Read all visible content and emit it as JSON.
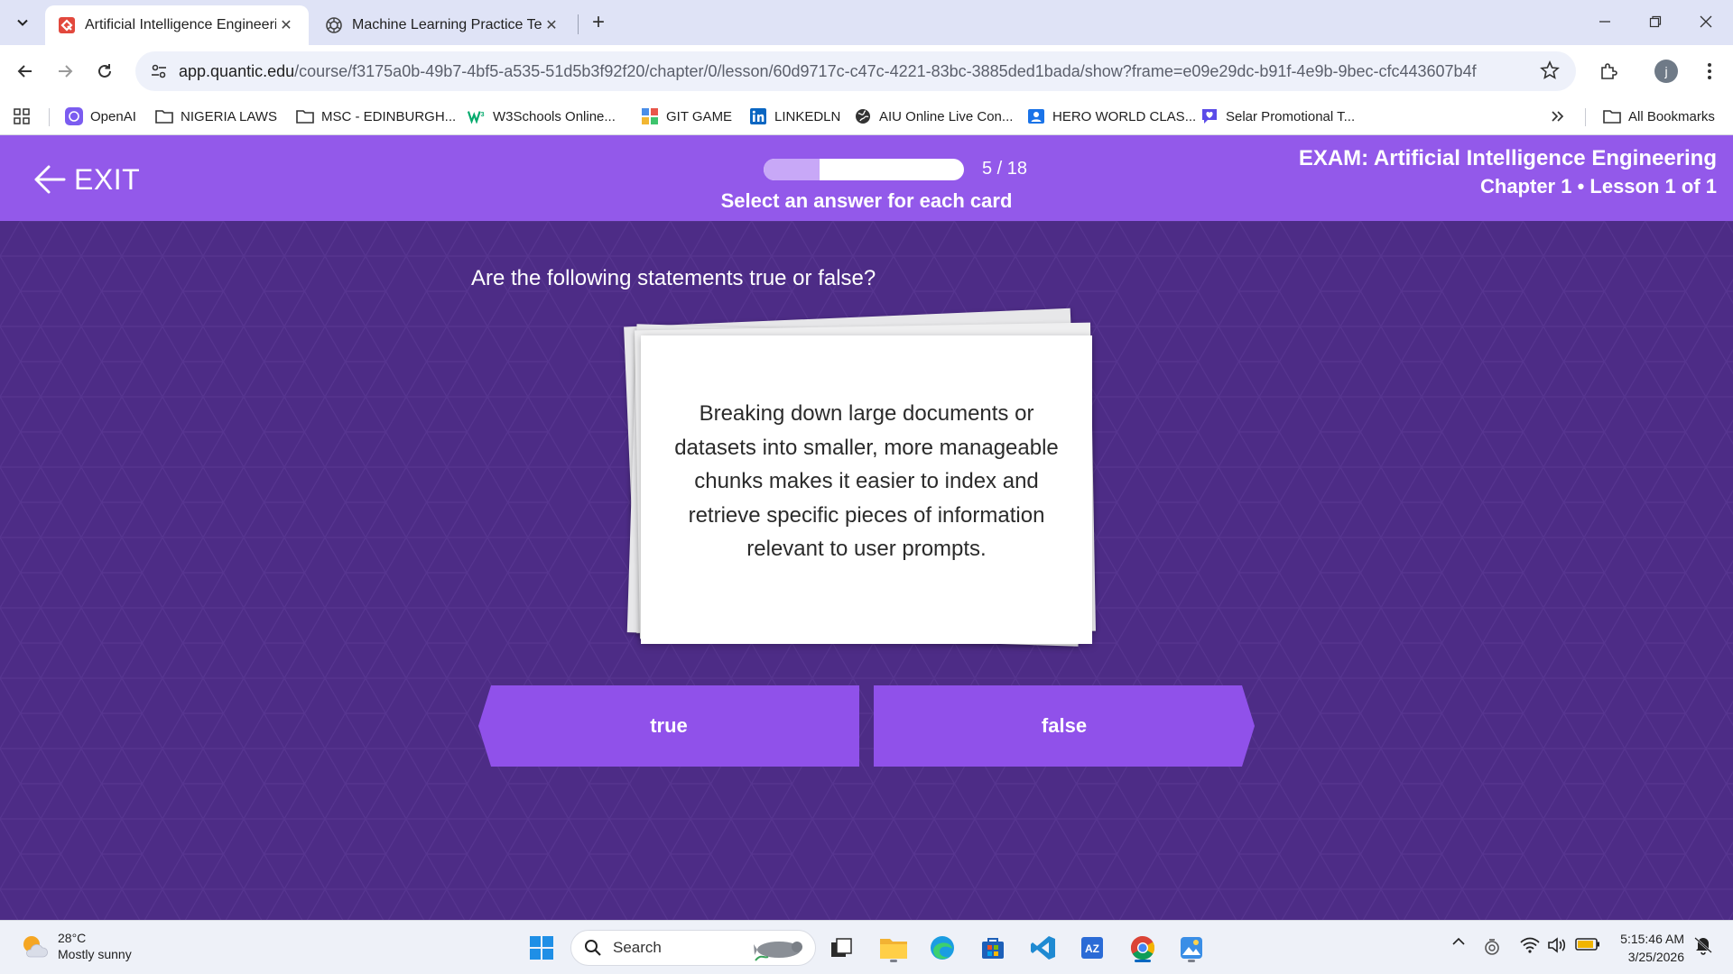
{
  "browser": {
    "tabs": [
      {
        "title": "Artificial Intelligence Engineering",
        "active": true,
        "favicon": "quantic-logo-icon"
      },
      {
        "title": "Machine Learning Practice Test",
        "active": false,
        "favicon": "openai-logo-icon"
      }
    ],
    "address": {
      "host": "app.quantic.edu",
      "path": "/course/f3175a0b-49b7-4bf5-a535-51d5b3f92f20/chapter/0/lesson/60d9717c-c47c-4221-83bc-3885ded1bada/show?frame=e09e29dc-b91f-4e9b-9bec-cfc443607b4f"
    },
    "profile_initial": "j",
    "bookmarks": [
      {
        "label": "OpenAI",
        "icon": "openai-icon"
      },
      {
        "label": "NIGERIA LAWS",
        "icon": "folder-icon"
      },
      {
        "label": "MSC - EDINBURGH...",
        "icon": "folder-icon"
      },
      {
        "label": "W3Schools Online...",
        "icon": "w3schools-icon"
      },
      {
        "label": "GIT GAME",
        "icon": "game-icon"
      },
      {
        "label": "LINKEDLN",
        "icon": "linkedin-icon"
      },
      {
        "label": "AIU Online Live Con...",
        "icon": "globe-icon"
      },
      {
        "label": "HERO WORLD CLAS...",
        "icon": "contact-icon"
      },
      {
        "label": "Selar Promotional T...",
        "icon": "heart-chat-icon"
      }
    ],
    "all_bookmarks": "All Bookmarks"
  },
  "lesson": {
    "exit_label": "EXIT",
    "progress": {
      "current": 5,
      "total": 18,
      "text": "5 / 18",
      "fraction": 0.28
    },
    "instruction": "Select an answer for each card",
    "exam_title": "EXAM: Artificial Intelligence Engineering",
    "exam_subtitle": "Chapter 1 • Lesson 1 of 1",
    "question": "Are the following statements true or false?",
    "card_text": "Breaking down large documents or datasets into smaller, more manageable chunks makes it easier to index and retrieve specific pieces of information relevant to user prompts.",
    "answers": {
      "true_label": "true",
      "false_label": "false"
    }
  },
  "colors": {
    "header_purple": "#9359ea",
    "background_purple": "#4d2c86",
    "button_purple": "#9051ea",
    "progress_fill": "#c8a8f7"
  },
  "taskbar": {
    "weather": {
      "temp": "28°C",
      "condition": "Mostly sunny"
    },
    "search_placeholder": "Search",
    "clock": {
      "time": "5:15:46 AM",
      "date": "3/25/2026"
    }
  }
}
